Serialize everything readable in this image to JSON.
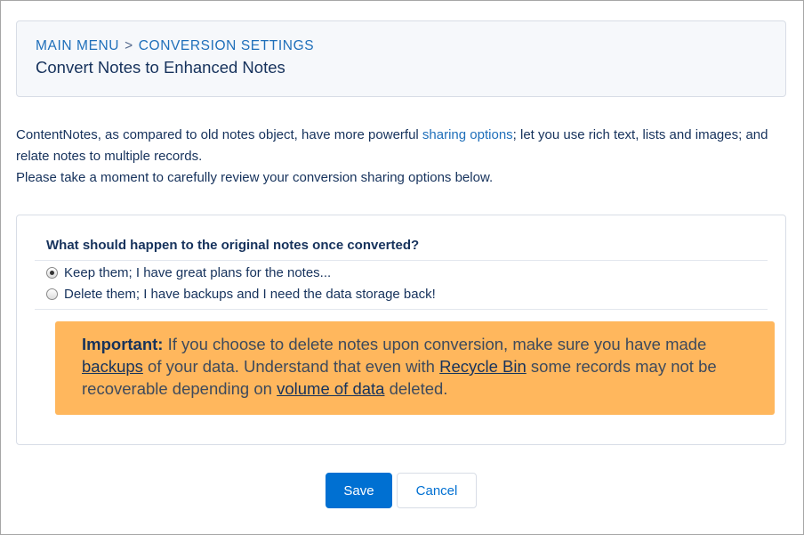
{
  "header": {
    "breadcrumb": {
      "main_menu": "MAIN MENU",
      "separator": ">",
      "current": "CONVERSION SETTINGS"
    },
    "title": "Convert Notes to Enhanced Notes"
  },
  "intro": {
    "text_before_link": "ContentNotes, as compared to old notes object, have more powerful ",
    "link_label": "sharing options",
    "text_after_link": "; let you use rich text, lists and images; and relate notes to multiple records.",
    "line2": "Please take a moment to carefully review your conversion sharing options below."
  },
  "options": {
    "question": "What should happen to the original notes once converted?",
    "choices": [
      {
        "label": "Keep them; I have great plans for the notes...",
        "selected": true
      },
      {
        "label": "Delete them; I have backups and I need the data storage back!",
        "selected": false
      }
    ]
  },
  "warning": {
    "heading": "Important:",
    "part1": " If you choose to delete notes upon conversion, make sure you have made ",
    "link_backups": "backups",
    "part2": " of your data. Understand that even with ",
    "link_recycle_bin": "Recycle Bin",
    "part3": " some records may not be recoverable depending on ",
    "link_volume": "volume of data",
    "part4": " deleted.",
    "background_color": "#ffb75d"
  },
  "actions": {
    "save_label": "Save",
    "cancel_label": "Cancel",
    "primary_color": "#0070d2"
  }
}
